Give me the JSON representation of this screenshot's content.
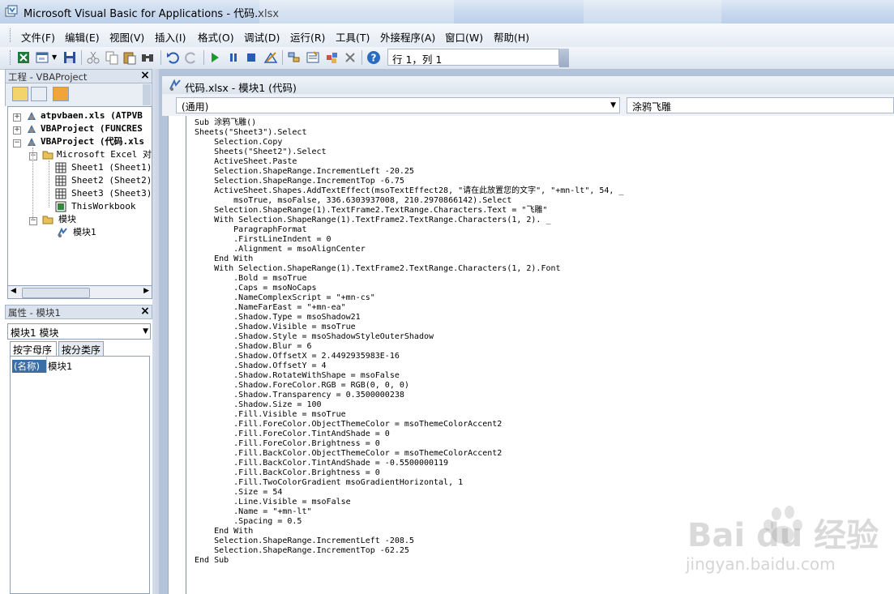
{
  "window": {
    "title": "Microsoft Visual Basic for Applications - 代码.xlsx"
  },
  "menu": [
    "文件(F)",
    "编辑(E)",
    "视图(V)",
    "插入(I)",
    "格式(O)",
    "调试(D)",
    "运行(R)",
    "工具(T)",
    "外接程序(A)",
    "窗口(W)",
    "帮助(H)"
  ],
  "toolbar": {
    "position_status": "行 1，列 1"
  },
  "project_panel": {
    "title": "工程 - VBAProject",
    "tree": [
      {
        "label": "atpvbaen.xls (ATPVB",
        "bold": true
      },
      {
        "label": "VBAProject (FUNCRES",
        "bold": true
      },
      {
        "label": "VBAProject (代码.xls",
        "bold": true
      },
      {
        "label": "Microsoft Excel 对象",
        "bold": false
      },
      {
        "label": "Sheet1 (Sheet1)",
        "bold": false
      },
      {
        "label": "Sheet2 (Sheet2)",
        "bold": false
      },
      {
        "label": "Sheet3 (Sheet3)",
        "bold": false
      },
      {
        "label": "ThisWorkbook",
        "bold": false
      },
      {
        "label": "模块",
        "bold": false
      },
      {
        "label": "模块1",
        "bold": false
      }
    ]
  },
  "properties_panel": {
    "title": "属性 - 模块1",
    "object": "模块1 模块",
    "tabs": [
      "按字母序",
      "按分类序"
    ],
    "rows": [
      {
        "key": "(名称)",
        "value": "模块1"
      }
    ]
  },
  "code_window": {
    "title": "代码.xlsx - 模块1 (代码)",
    "object_dropdown": "(通用)",
    "proc_dropdown": "涂鸦飞雕",
    "lines": [
      "Sub 涂鸦飞雕()",
      "Sheets(\"Sheet3\").Select",
      "    Selection.Copy",
      "    Sheets(\"Sheet2\").Select",
      "    ActiveSheet.Paste",
      "    Selection.ShapeRange.IncrementLeft -20.25",
      "    Selection.ShapeRange.IncrementTop -6.75",
      "    ActiveSheet.Shapes.AddTextEffect(msoTextEffect28, \"请在此放置您的文字\", \"+mn-lt\", 54, _",
      "        msoTrue, msoFalse, 336.6303937008, 210.2970866142).Select",
      "    Selection.ShapeRange(1).TextFrame2.TextRange.Characters.Text = \"飞雕\"",
      "    With Selection.ShapeRange(1).TextFrame2.TextRange.Characters(1, 2). _",
      "        ParagraphFormat",
      "        .FirstLineIndent = 0",
      "        .Alignment = msoAlignCenter",
      "    End With",
      "    With Selection.ShapeRange(1).TextFrame2.TextRange.Characters(1, 2).Font",
      "        .Bold = msoTrue",
      "        .Caps = msoNoCaps",
      "        .NameComplexScript = \"+mn-cs\"",
      "        .NameFarEast = \"+mn-ea\"",
      "        .Shadow.Type = msoShadow21",
      "        .Shadow.Visible = msoTrue",
      "        .Shadow.Style = msoShadowStyleOuterShadow",
      "        .Shadow.Blur = 6",
      "        .Shadow.OffsetX = 2.4492935983E-16",
      "        .Shadow.OffsetY = 4",
      "        .Shadow.RotateWithShape = msoFalse",
      "        .Shadow.ForeColor.RGB = RGB(0, 0, 0)",
      "        .Shadow.Transparency = 0.3500000238",
      "        .Shadow.Size = 100",
      "        .Fill.Visible = msoTrue",
      "        .Fill.ForeColor.ObjectThemeColor = msoThemeColorAccent2",
      "        .Fill.ForeColor.TintAndShade = 0",
      "        .Fill.ForeColor.Brightness = 0",
      "        .Fill.BackColor.ObjectThemeColor = msoThemeColorAccent2",
      "        .Fill.BackColor.TintAndShade = -0.5500000119",
      "        .Fill.BackColor.Brightness = 0",
      "        .Fill.TwoColorGradient msoGradientHorizontal, 1",
      "        .Size = 54",
      "        .Line.Visible = msoFalse",
      "        .Name = \"+mn-lt\"",
      "        .Spacing = 0.5",
      "    End With",
      "    Selection.ShapeRange.IncrementLeft -208.5",
      "    Selection.ShapeRange.IncrementTop -62.25",
      "End Sub"
    ]
  },
  "watermark": {
    "brand": "Bai du 经验",
    "url": "jingyan.baidu.com"
  }
}
